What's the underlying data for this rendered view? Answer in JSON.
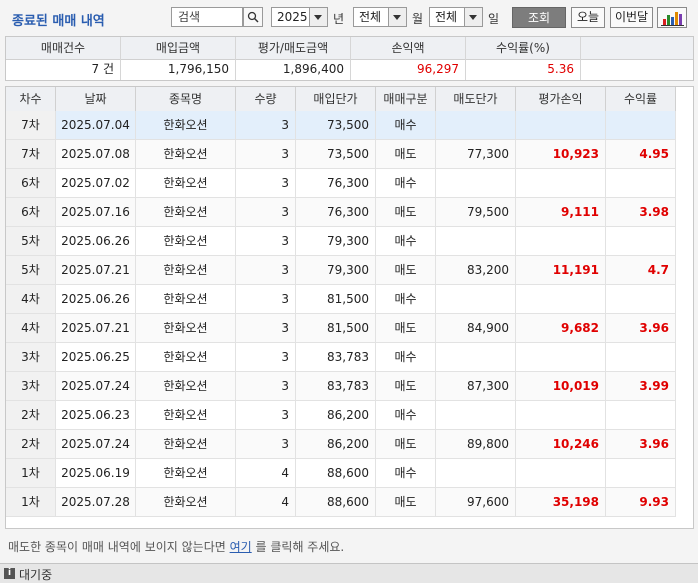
{
  "toolbar": {
    "title": "종료된 매매 내역",
    "search_value": "검색",
    "year": "2025",
    "year_suffix": "년",
    "month": "전체",
    "month_suffix": "월",
    "day": "전체",
    "day_suffix": "일",
    "query_label": "조회",
    "today_label": "오늘",
    "this_month_label": "이번달",
    "chart_icon": "bar-chart-icon"
  },
  "summary": {
    "headers": [
      "매매건수",
      "매입금액",
      "평가/매도금액",
      "손익액",
      "수익률(%)"
    ],
    "values": {
      "count": "7 건",
      "buy_amount": "1,796,150",
      "sell_amount": "1,896,400",
      "profit": "96,297",
      "return_rate": "5.36"
    }
  },
  "grid": {
    "headers": [
      "차수",
      "날짜",
      "종목명",
      "수량",
      "매입단가",
      "매매구분",
      "매도단가",
      "평가손익",
      "수익률"
    ],
    "rows": [
      {
        "round": "7차",
        "date": "2025.07.04",
        "name": "한화오션",
        "qty": "3",
        "buy_price": "73,500",
        "type": "매수",
        "sell_price": "",
        "pnl": "",
        "rate": ""
      },
      {
        "round": "7차",
        "date": "2025.07.08",
        "name": "한화오션",
        "qty": "3",
        "buy_price": "73,500",
        "type": "매도",
        "sell_price": "77,300",
        "pnl": "10,923",
        "rate": "4.95"
      },
      {
        "round": "6차",
        "date": "2025.07.02",
        "name": "한화오션",
        "qty": "3",
        "buy_price": "76,300",
        "type": "매수",
        "sell_price": "",
        "pnl": "",
        "rate": ""
      },
      {
        "round": "6차",
        "date": "2025.07.16",
        "name": "한화오션",
        "qty": "3",
        "buy_price": "76,300",
        "type": "매도",
        "sell_price": "79,500",
        "pnl": "9,111",
        "rate": "3.98"
      },
      {
        "round": "5차",
        "date": "2025.06.26",
        "name": "한화오션",
        "qty": "3",
        "buy_price": "79,300",
        "type": "매수",
        "sell_price": "",
        "pnl": "",
        "rate": ""
      },
      {
        "round": "5차",
        "date": "2025.07.21",
        "name": "한화오션",
        "qty": "3",
        "buy_price": "79,300",
        "type": "매도",
        "sell_price": "83,200",
        "pnl": "11,191",
        "rate": "4.7"
      },
      {
        "round": "4차",
        "date": "2025.06.26",
        "name": "한화오션",
        "qty": "3",
        "buy_price": "81,500",
        "type": "매수",
        "sell_price": "",
        "pnl": "",
        "rate": ""
      },
      {
        "round": "4차",
        "date": "2025.07.21",
        "name": "한화오션",
        "qty": "3",
        "buy_price": "81,500",
        "type": "매도",
        "sell_price": "84,900",
        "pnl": "9,682",
        "rate": "3.96"
      },
      {
        "round": "3차",
        "date": "2025.06.25",
        "name": "한화오션",
        "qty": "3",
        "buy_price": "83,783",
        "type": "매수",
        "sell_price": "",
        "pnl": "",
        "rate": ""
      },
      {
        "round": "3차",
        "date": "2025.07.24",
        "name": "한화오션",
        "qty": "3",
        "buy_price": "83,783",
        "type": "매도",
        "sell_price": "87,300",
        "pnl": "10,019",
        "rate": "3.99"
      },
      {
        "round": "2차",
        "date": "2025.06.23",
        "name": "한화오션",
        "qty": "3",
        "buy_price": "86,200",
        "type": "매수",
        "sell_price": "",
        "pnl": "",
        "rate": ""
      },
      {
        "round": "2차",
        "date": "2025.07.24",
        "name": "한화오션",
        "qty": "3",
        "buy_price": "86,200",
        "type": "매도",
        "sell_price": "89,800",
        "pnl": "10,246",
        "rate": "3.96"
      },
      {
        "round": "1차",
        "date": "2025.06.19",
        "name": "한화오션",
        "qty": "4",
        "buy_price": "88,600",
        "type": "매수",
        "sell_price": "",
        "pnl": "",
        "rate": ""
      },
      {
        "round": "1차",
        "date": "2025.07.28",
        "name": "한화오션",
        "qty": "4",
        "buy_price": "88,600",
        "type": "매도",
        "sell_price": "97,600",
        "pnl": "35,198",
        "rate": "9.93"
      }
    ]
  },
  "notice": {
    "before": "매도한 종목이 매매 내역에 보이지 않는다면 ",
    "link": "여기",
    "after": " 를 클릭해 주세요."
  },
  "status": {
    "icon": "info-icon",
    "text": "대기중"
  },
  "colors": {
    "accent": "#2a5db0",
    "profit": "#e00000",
    "selected_row": "#e3effb"
  }
}
